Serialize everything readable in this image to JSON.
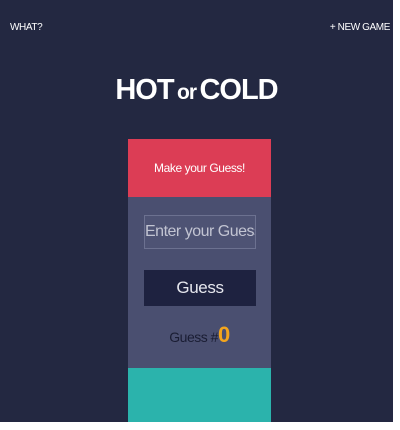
{
  "nav": {
    "what_label": "WHAT?",
    "new_game_label": "+ NEW GAME"
  },
  "title": {
    "part1": "HOT",
    "part2": "or",
    "part3": "COLD"
  },
  "game": {
    "header_text": "Make your Guess!",
    "input_placeholder": "Enter your Guess",
    "input_value": "",
    "button_label": "Guess",
    "counter_label": "Guess #",
    "counter_value": "0",
    "feedback_text": ""
  },
  "colors": {
    "background": "#232841",
    "header_red": "#dc3d55",
    "card_panel": "#4a4f70",
    "button_dark": "#1e2240",
    "count_orange": "#f4a51c",
    "feedback_teal": "#2bb3ac"
  }
}
